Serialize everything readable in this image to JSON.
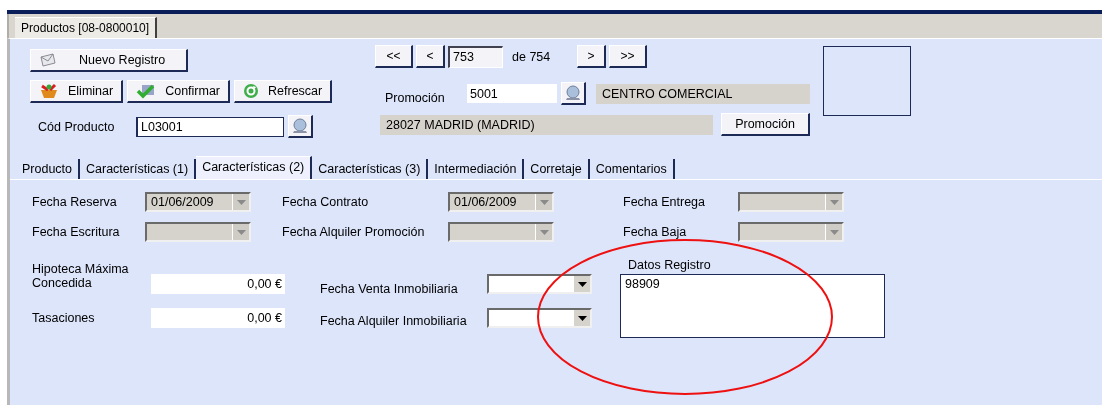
{
  "window": {
    "tab": "Productos [08-0800010]"
  },
  "new_record_button": {
    "label": "Nuevo Registro"
  },
  "actions": [
    {
      "kind": "delete",
      "label": "Eliminar"
    },
    {
      "kind": "confirm",
      "label": "Confirmar"
    },
    {
      "kind": "refresh",
      "label": "Refrescar"
    }
  ],
  "product_code": {
    "label": "Cód Producto",
    "value": "L03001"
  },
  "navigation": {
    "first": "<<",
    "previous": "<",
    "record": "753",
    "total": "de 754",
    "next": ">",
    "last": ">>"
  },
  "promotion": {
    "label": "Promoción",
    "code": "5001",
    "name": "CENTRO COMERCIAL",
    "address": "28027 MADRID (MADRID)",
    "button": "Promoción"
  },
  "tabs": [
    {
      "label": "Producto",
      "selected": false
    },
    {
      "label": "Características (1)",
      "selected": false
    },
    {
      "label": "Características (2)",
      "selected": true
    },
    {
      "label": "Características (3)",
      "selected": false
    },
    {
      "label": "Intermediación",
      "selected": false
    },
    {
      "label": "Corretaje",
      "selected": false
    },
    {
      "label": "Comentarios",
      "selected": false
    }
  ],
  "date_fields": [
    {
      "label": "Fecha Reserva",
      "value": "01/06/2009",
      "disabled": true
    },
    {
      "label": "Fecha Contrato",
      "value": "01/06/2009",
      "disabled": true
    },
    {
      "label": "Fecha Entrega",
      "disabled": true
    },
    {
      "label": "Fecha Escritura",
      "disabled": true
    },
    {
      "label": "Fecha Alquiler Promoción",
      "disabled": true
    },
    {
      "label": "Fecha Baja",
      "disabled": true
    }
  ],
  "amounts": [
    {
      "label": "Hipoteca Máxima Concedida",
      "value": "0,00 €"
    },
    {
      "label": "Tasaciones",
      "value": "0,00 €"
    }
  ],
  "property_dates": [
    {
      "label": "Fecha Venta Inmobiliaria",
      "disabled": false
    },
    {
      "label": "Fecha Alquiler Inmobiliaria",
      "disabled": false
    }
  ],
  "registry": {
    "label": "Datos Registro",
    "value": "98909"
  }
}
